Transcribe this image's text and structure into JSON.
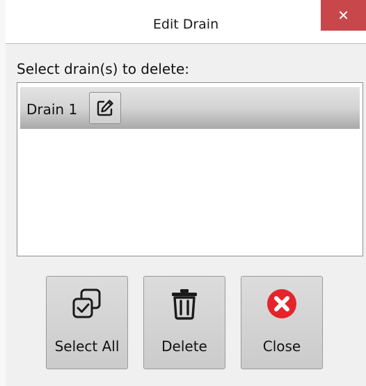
{
  "dialog": {
    "title": "Edit Drain",
    "close_glyph": "✕",
    "prompt": "Select drain(s) to delete:"
  },
  "list": {
    "items": [
      {
        "label": "Drain 1",
        "icon": "edit-icon"
      }
    ]
  },
  "buttons": {
    "select_all": {
      "label": "Select All",
      "icon": "select-all-icon"
    },
    "delete": {
      "label": "Delete",
      "icon": "trash-icon"
    },
    "close": {
      "label": "Close",
      "icon": "close-circle-icon"
    }
  },
  "colors": {
    "title_close_bg": "#c8474b",
    "close_icon_red": "#e5242b"
  }
}
